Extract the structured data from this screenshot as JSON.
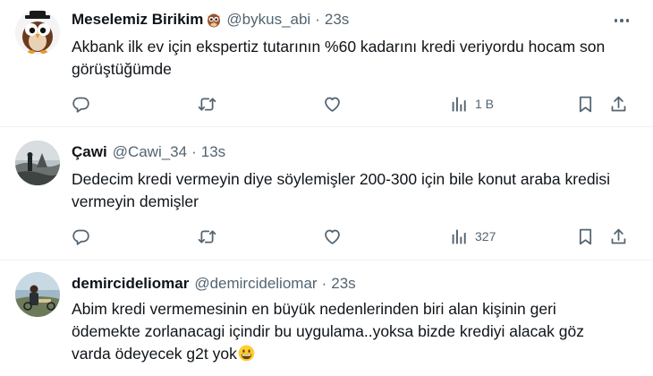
{
  "tweets": [
    {
      "name": "Meselemiz Birikim",
      "handle": "@bykus_abi",
      "dot": "·",
      "time": "23s",
      "text": "Akbank ilk ev için ekspertiz tutarının %60 kadarını kredi veriyordu hocam son görüştüğümde",
      "views": "1 B"
    },
    {
      "name": "Çawi",
      "handle": "@Cawi_34",
      "dot": "·",
      "time": "13s",
      "text": "Dedecim kredi vermeyin diye söylemişler 200-300 için bile konut araba kredisi vermeyin demişler",
      "views": "327"
    },
    {
      "name": "demircideliomar",
      "handle": "@demircideliomar",
      "dot": "·",
      "time": "23s",
      "text": "Abim kredi vermemesinin en büyük nedenlerinden biri alan kişinin geri ödemekte zorlanacagi içindir bu uygulama..yoksa bizde krediyi alacak göz varda ödeyecek g2t yok"
    }
  ],
  "icons": {
    "reply": "reply-icon",
    "retweet": "retweet-icon",
    "like": "heart-icon",
    "views": "views-icon",
    "bookmark": "bookmark-icon",
    "share": "share-icon",
    "more": "more-icon",
    "owl_emoji": "owl-emoji-icon",
    "grin_emoji": "grinning-emoji-icon"
  },
  "colors": {
    "text_primary": "#0f1419",
    "text_secondary": "#536471",
    "divider": "#eff3f4"
  }
}
